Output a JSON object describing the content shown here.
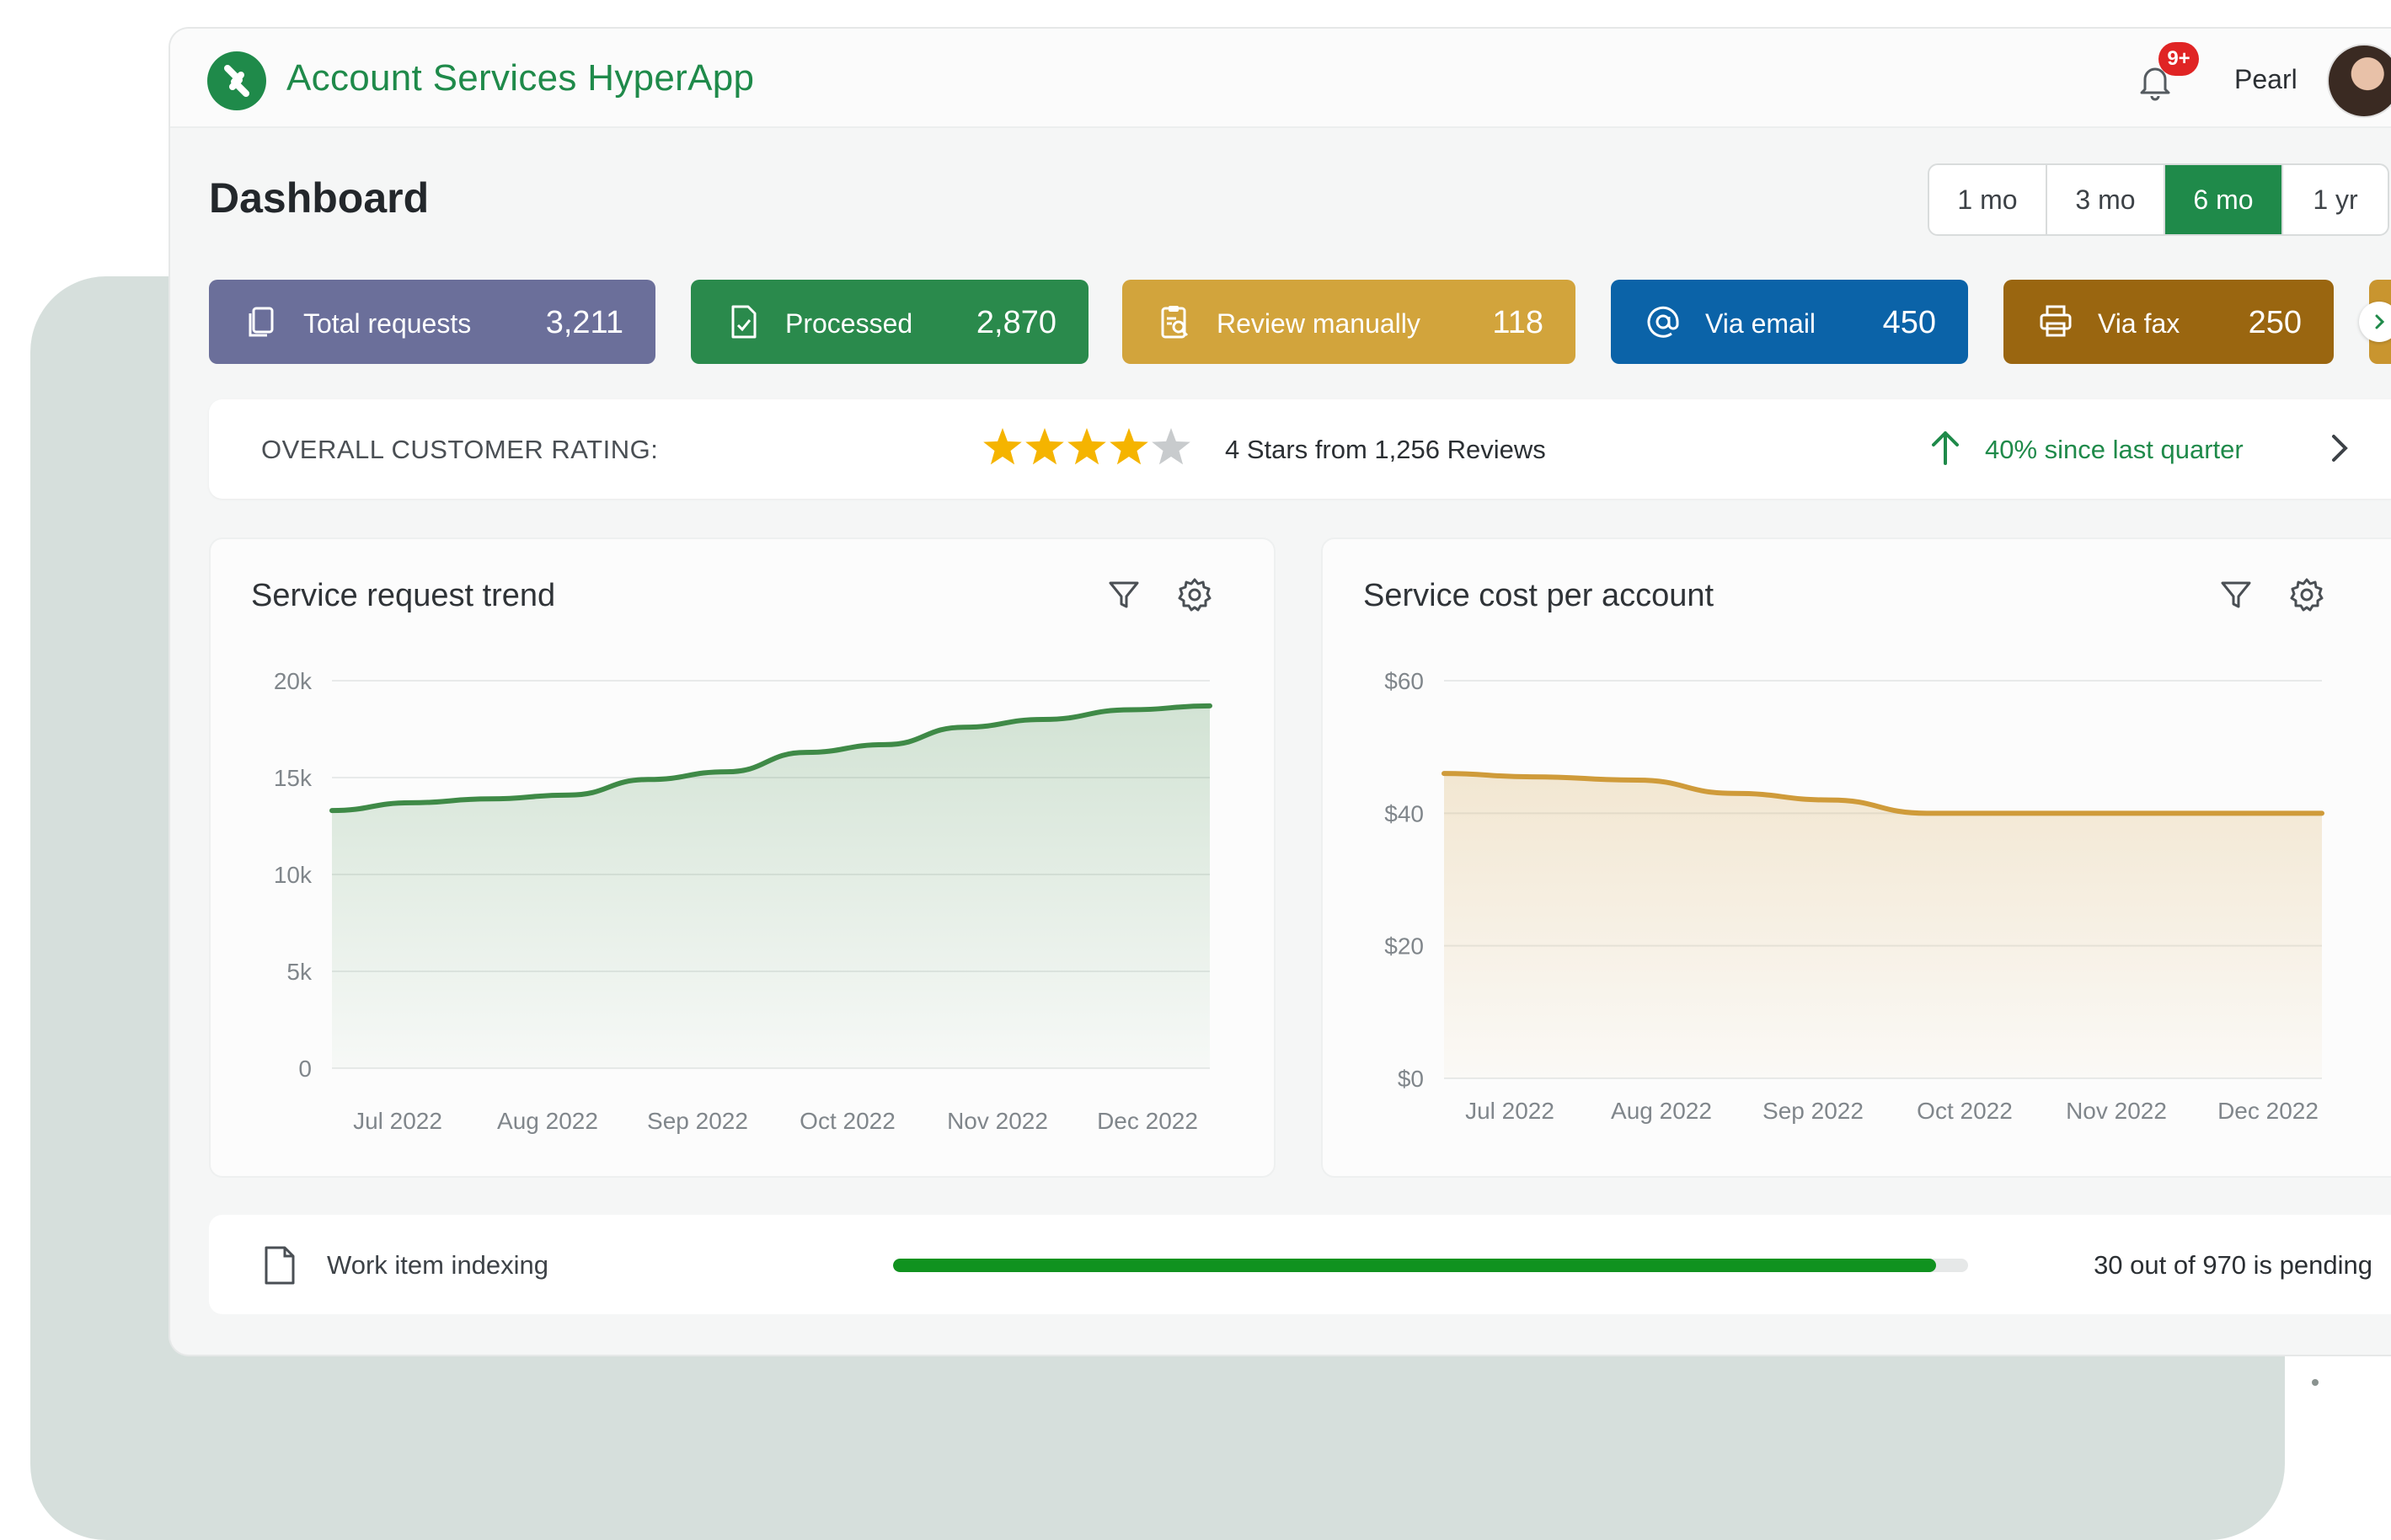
{
  "app": {
    "title": "Account Services HyperApp"
  },
  "header": {
    "notification_badge": "9+",
    "user_name": "Pearl"
  },
  "page": {
    "title": "Dashboard"
  },
  "time_range": {
    "options": [
      "1 mo",
      "3 mo",
      "6 mo",
      "1 yr"
    ],
    "selected": "6 mo"
  },
  "stats": [
    {
      "label": "Total requests",
      "value": "3,211",
      "icon": "copy-icon",
      "color": "#6b6f9a"
    },
    {
      "label": "Processed",
      "value": "2,870",
      "icon": "document-check-icon",
      "color": "#2a8a4c"
    },
    {
      "label": "Review manually",
      "value": "118",
      "icon": "clipboard-search-icon",
      "color": "#d2a43c"
    },
    {
      "label": "Via email",
      "value": "450",
      "icon": "at-sign-icon",
      "color": "#0b63a8"
    },
    {
      "label": "Via fax",
      "value": "250",
      "icon": "printer-icon",
      "color": "#9a6610"
    }
  ],
  "rating": {
    "label": "OVERALL CUSTOMER RATING:",
    "stars": 4,
    "max_stars": 5,
    "summary": "4 Stars from 1,256 Reviews",
    "trend": "40% since last quarter"
  },
  "charts": {
    "left_title": "Service request trend",
    "right_title": "Service cost per account"
  },
  "chart_data": [
    {
      "type": "area",
      "title": "Service request trend",
      "x": [
        "Jul 2022",
        "Aug 2022",
        "Sep 2022",
        "Oct 2022",
        "Nov 2022",
        "Dec 2022"
      ],
      "y_ticks": [
        "0",
        "5k",
        "10k",
        "15k",
        "20k"
      ],
      "ylim": [
        0,
        20000
      ],
      "grid": true,
      "series": [
        {
          "values": [
            13300,
            13700,
            13900,
            14100,
            14900,
            15300,
            16300,
            16700,
            17600,
            18000,
            18500,
            18700
          ],
          "color": "#3f8a47"
        }
      ],
      "x_positions": [
        0,
        0.09,
        0.18,
        0.27,
        0.36,
        0.45,
        0.54,
        0.63,
        0.72,
        0.81,
        0.91,
        1.0
      ]
    },
    {
      "type": "area",
      "title": "Service cost per account",
      "x": [
        "Jul 2022",
        "Aug 2022",
        "Sep 2022",
        "Oct 2022",
        "Nov 2022",
        "Dec 2022"
      ],
      "y_ticks": [
        "$0",
        "$20",
        "$40",
        "$60"
      ],
      "ylim": [
        0,
        60
      ],
      "grid": true,
      "series": [
        {
          "values": [
            46,
            45.5,
            45,
            43,
            42,
            40,
            40,
            40,
            40,
            40
          ],
          "color": "#cf9b3a"
        }
      ],
      "x_positions": [
        0,
        0.1,
        0.22,
        0.33,
        0.44,
        0.55,
        0.66,
        0.77,
        0.88,
        1.0
      ]
    }
  ],
  "indexing": {
    "label": "Work item indexing",
    "status": "30 out of 970 is pending",
    "progress": 0.97
  }
}
